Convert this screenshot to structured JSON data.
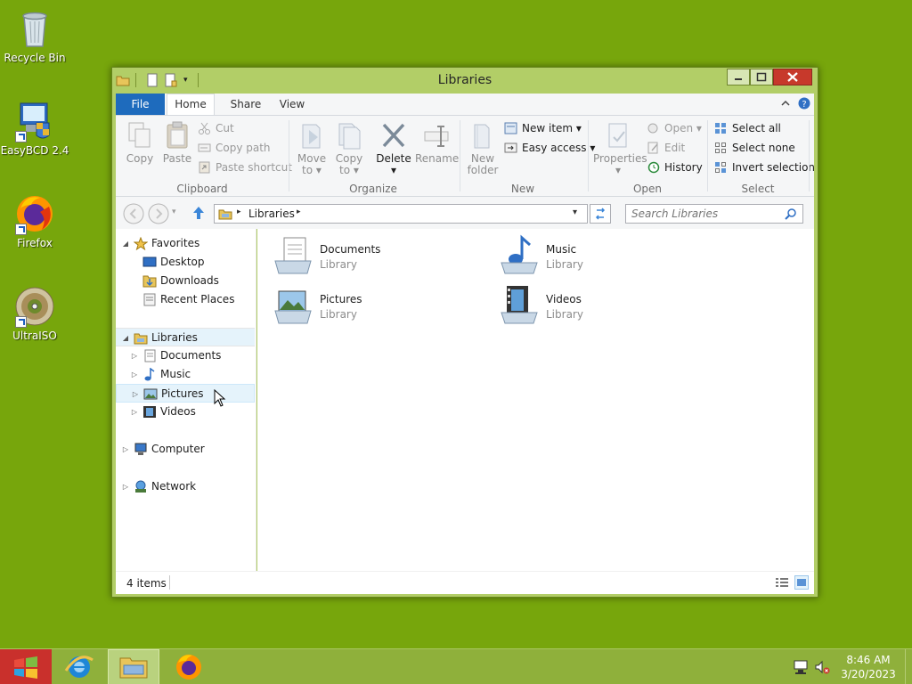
{
  "desktop": {
    "icons": [
      {
        "label": "Recycle Bin"
      },
      {
        "label": "EasyBCD 2.4"
      },
      {
        "label": "Firefox"
      },
      {
        "label": "UltraISO"
      }
    ]
  },
  "window": {
    "title": "Libraries",
    "tabs": [
      "File",
      "Home",
      "Share",
      "View"
    ],
    "ribbon": {
      "clipboard": {
        "label": "Clipboard",
        "copy": "Copy",
        "paste": "Paste",
        "cut": "Cut",
        "copy_path": "Copy path",
        "paste_shortcut": "Paste shortcut"
      },
      "organize": {
        "label": "Organize",
        "move_to": [
          "Move",
          "to ▾"
        ],
        "copy_to": [
          "Copy",
          "to ▾"
        ],
        "delete": "Delete",
        "delete_arrow": "▾",
        "rename": "Rename"
      },
      "new": {
        "label": "New",
        "new_folder": [
          "New",
          "folder"
        ],
        "new_item": "New item ▾",
        "easy_access": "Easy access ▾"
      },
      "open": {
        "label": "Open",
        "properties": "Properties",
        "properties_arrow": "▾",
        "open": "Open ▾",
        "edit": "Edit",
        "history": "History"
      },
      "select": {
        "label": "Select",
        "select_all": "Select all",
        "select_none": "Select none",
        "invert": "Invert selection"
      }
    },
    "address": {
      "path": "Libraries",
      "sep": "▸"
    },
    "search": {
      "placeholder": "Search Libraries"
    },
    "nav": {
      "favorites": "Favorites",
      "favorites_items": [
        "Desktop",
        "Downloads",
        "Recent Places"
      ],
      "libraries": "Libraries",
      "libraries_items": [
        "Documents",
        "Music",
        "Pictures",
        "Videos"
      ],
      "computer": "Computer",
      "network": "Network"
    },
    "items": [
      {
        "name": "Documents",
        "type": "Library"
      },
      {
        "name": "Music",
        "type": "Library"
      },
      {
        "name": "Pictures",
        "type": "Library"
      },
      {
        "name": "Videos",
        "type": "Library"
      }
    ],
    "status": "4 items"
  },
  "taskbar": {
    "time": "8:46 AM",
    "date": "3/20/2023"
  },
  "colors": {
    "desktop": "#77a60c",
    "window_frame": "#b2ce67",
    "file_tab": "#1e6bbd",
    "close": "#c7392b",
    "taskbar": "#8fb03b"
  }
}
